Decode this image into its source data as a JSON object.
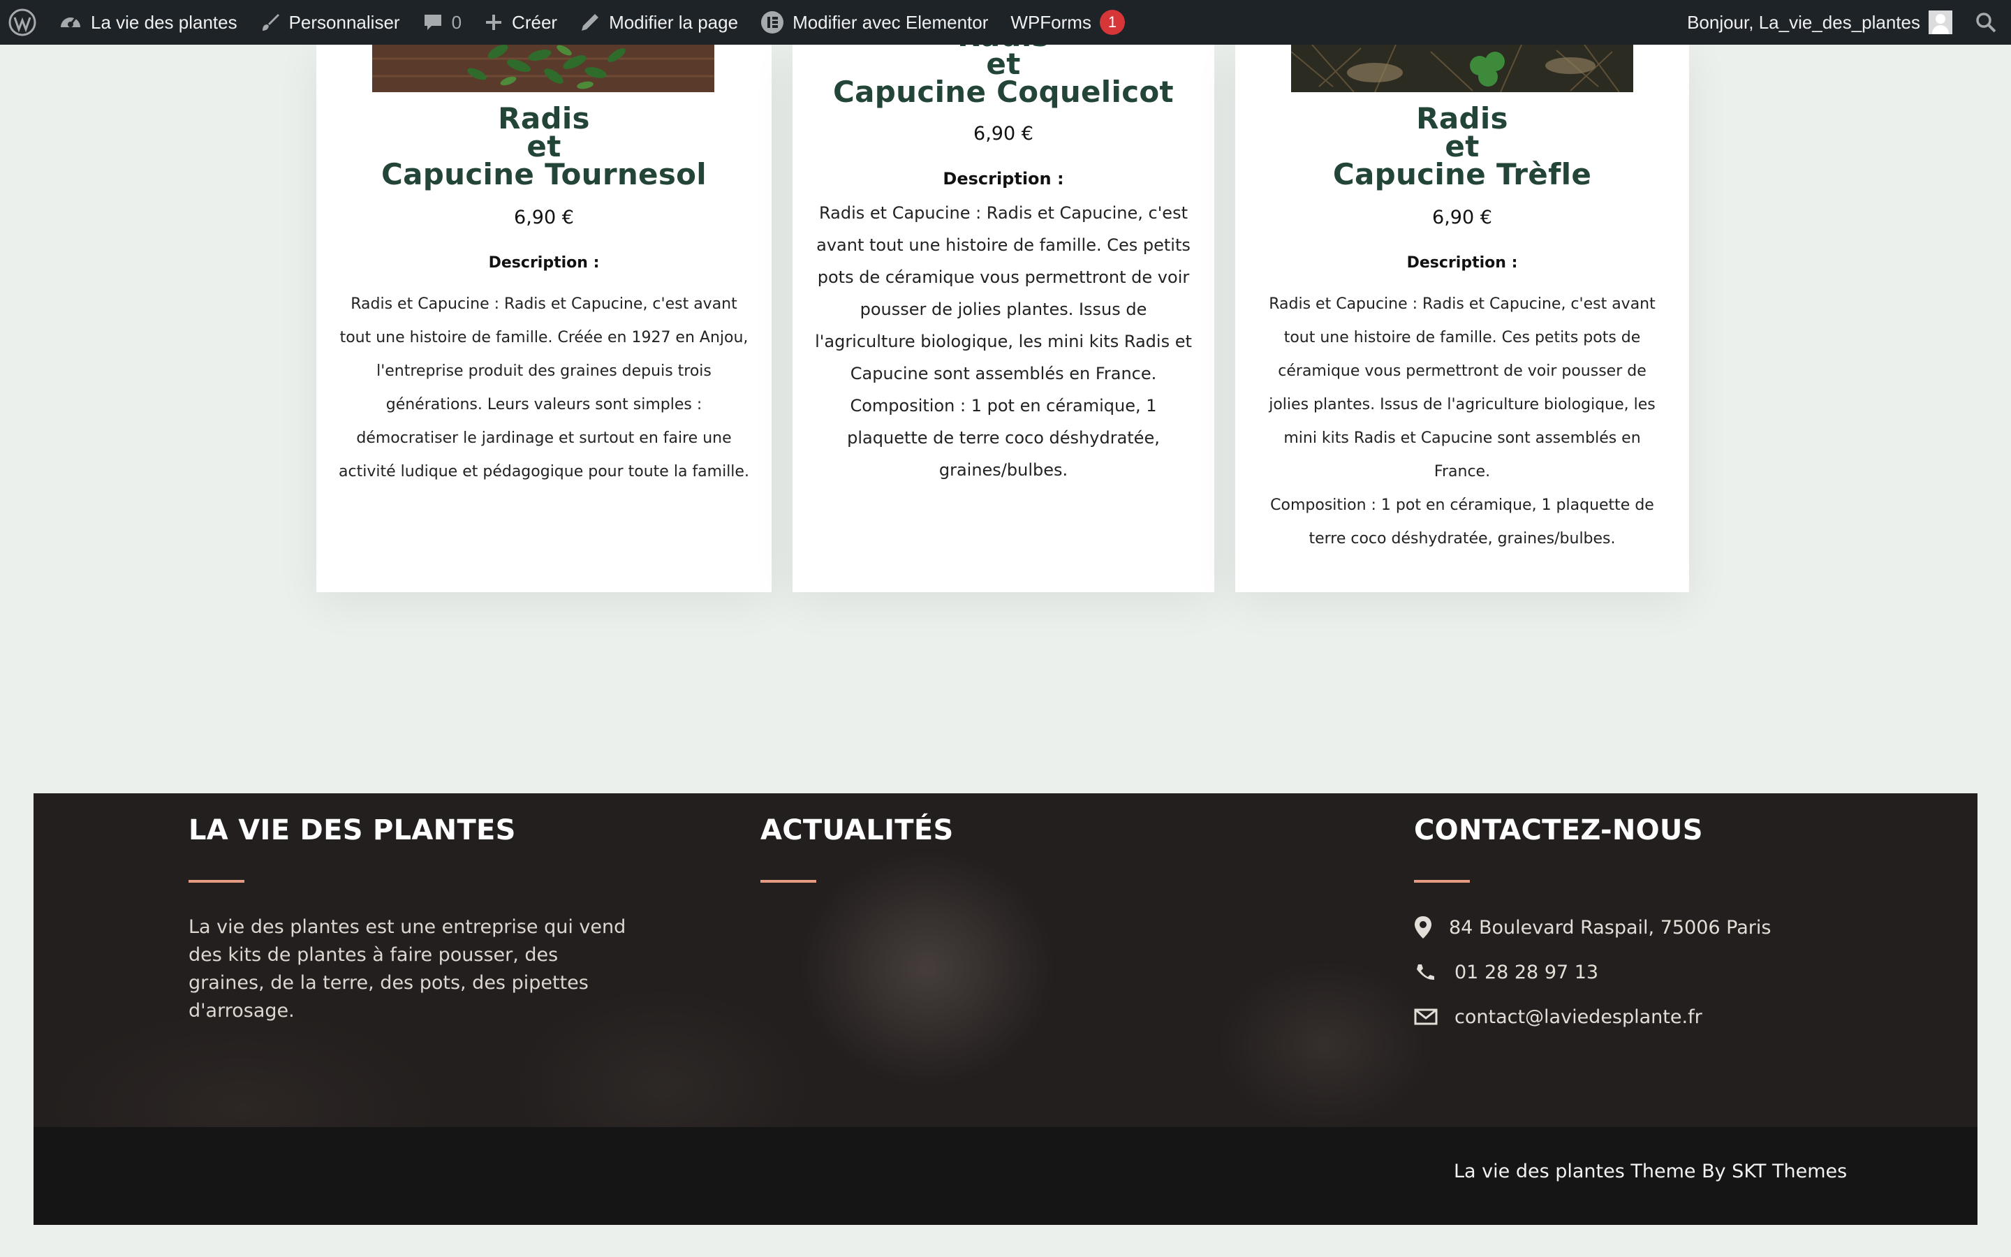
{
  "admin_bar": {
    "site_name": "La vie des plantes",
    "customize": "Personnaliser",
    "comments_count": "0",
    "new": "Créer",
    "edit_page": "Modifier la page",
    "elementor": "Modifier avec Elementor",
    "wpforms": "WPForms",
    "wpforms_badge": "1",
    "greeting": "Bonjour, La_vie_des_plantes"
  },
  "products": [
    {
      "title_lines": [
        "Radis",
        "et",
        "Capucine Tournesol"
      ],
      "price": "6,90 €",
      "desc_title": "Description :",
      "desc_lines": [
        "Radis et Capucine : Radis et Capucine, c'est avant",
        "tout une histoire de famille. Créée en 1927 en Anjou,",
        "l'entreprise produit des graines depuis trois",
        "générations. Leurs valeurs sont simples :",
        "démocratiser le jardinage et surtout en faire une",
        "activité ludique et pédagogique pour toute la famille."
      ]
    },
    {
      "title_lines": [
        "Radis",
        "et",
        "Capucine Coquelicot"
      ],
      "price": "6,90 €",
      "desc_title": "Description :",
      "desc_lines": [
        "Radis et Capucine : Radis et Capucine, c'est",
        "avant tout une histoire de famille. Ces petits",
        "pots de céramique vous permettront de voir",
        "pousser de jolies plantes. Issus de",
        "l'agriculture biologique, les mini kits Radis et",
        "Capucine sont assemblés en France.",
        "Composition : 1 pot en céramique, 1",
        "plaquette de terre coco déshydratée,",
        "graines/bulbes."
      ]
    },
    {
      "title_lines": [
        "Radis",
        "et",
        "Capucine Trèfle"
      ],
      "price": "6,90 €",
      "desc_title": "Description :",
      "desc_lines": [
        "Radis et Capucine : Radis et Capucine, c'est avant",
        "tout une histoire de famille. Ces petits pots de",
        "céramique vous permettront de voir pousser de",
        "jolies plantes. Issus de l'agriculture biologique, les",
        "mini kits Radis et Capucine sont assemblés en",
        "France.",
        "Composition : 1 pot en céramique, 1 plaquette de",
        "terre coco déshydratée, graines/bulbes."
      ]
    }
  ],
  "footer": {
    "about": {
      "heading": "LA VIE DES PLANTES",
      "text_lines": [
        "La vie des plantes est une entreprise qui vend",
        "des kits de plantes à faire pousser, des",
        "graines, de la terre, des pots, des pipettes",
        "d'arrosage."
      ]
    },
    "news": {
      "heading": "ACTUALITÉS"
    },
    "contact": {
      "heading": "CONTACTEZ-NOUS",
      "address": "84 Boulevard Raspail, 75006 Paris",
      "phone": "01 28 28 97 13",
      "email": "contact@laviedesplante.fr"
    },
    "credit": "La vie des plantes Theme By SKT Themes",
    "accent_color": "#e49b82"
  }
}
